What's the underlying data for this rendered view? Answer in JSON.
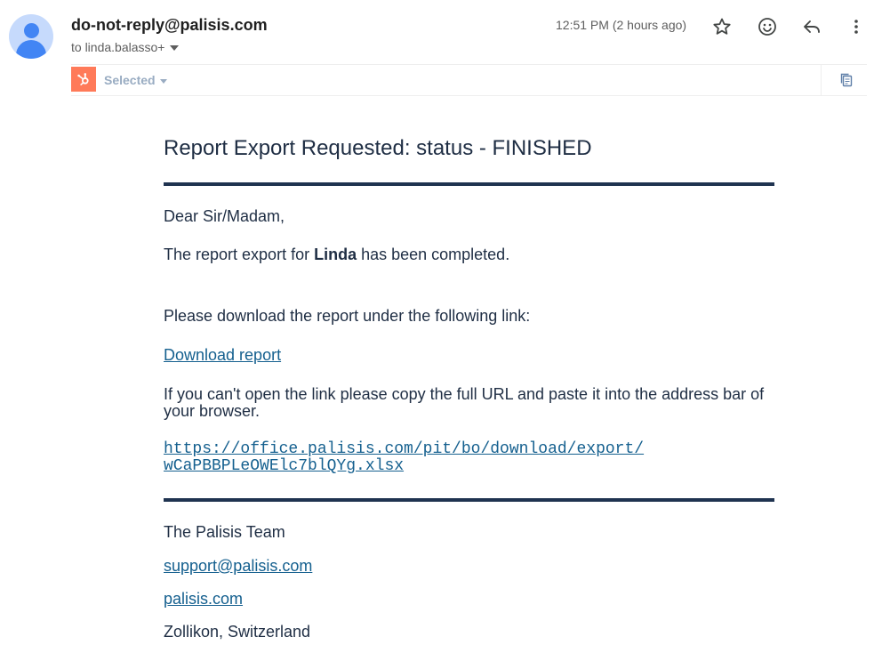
{
  "header": {
    "sender": "do-not-reply@palisis.com",
    "recipient": "to linda.balasso+",
    "timestamp": "12:51 PM (2 hours ago)"
  },
  "icons": {
    "star": "star-icon",
    "emoji": "emoji-icon",
    "reply": "reply-icon",
    "more": "more-vert-icon",
    "hubspot": "hubspot-logo-icon",
    "copy": "copy-icon"
  },
  "addon": {
    "selected_label": "Selected"
  },
  "email": {
    "title": "Report Export Requested: status - FINISHED",
    "greeting": "Dear Sir/Madam,",
    "export_prefix": "The report export for ",
    "export_name": "Linda",
    "export_suffix": " has been completed.",
    "download_instruction": "Please download the report under the following link:",
    "download_link": "Download report",
    "fallback_text": "If you can't open the link please copy the full URL and paste it into the address bar of your browser.",
    "url_line1": "https://office.palisis.com/pit/bo/download/export/",
    "url_line2": "wCaPBBPLeOWElc7blQYg.xlsx",
    "signature_team": "The Palisis Team",
    "support_email": "support@palisis.com",
    "website": "palisis.com",
    "location": "Zollikon, Switzerland"
  },
  "colors": {
    "text": "#1f2e44",
    "rule": "#1f3350",
    "link": "#15608f",
    "hubspot_orange": "#ff7a59",
    "avatar_bg": "#c6dafc",
    "avatar_fg": "#4285f4"
  }
}
